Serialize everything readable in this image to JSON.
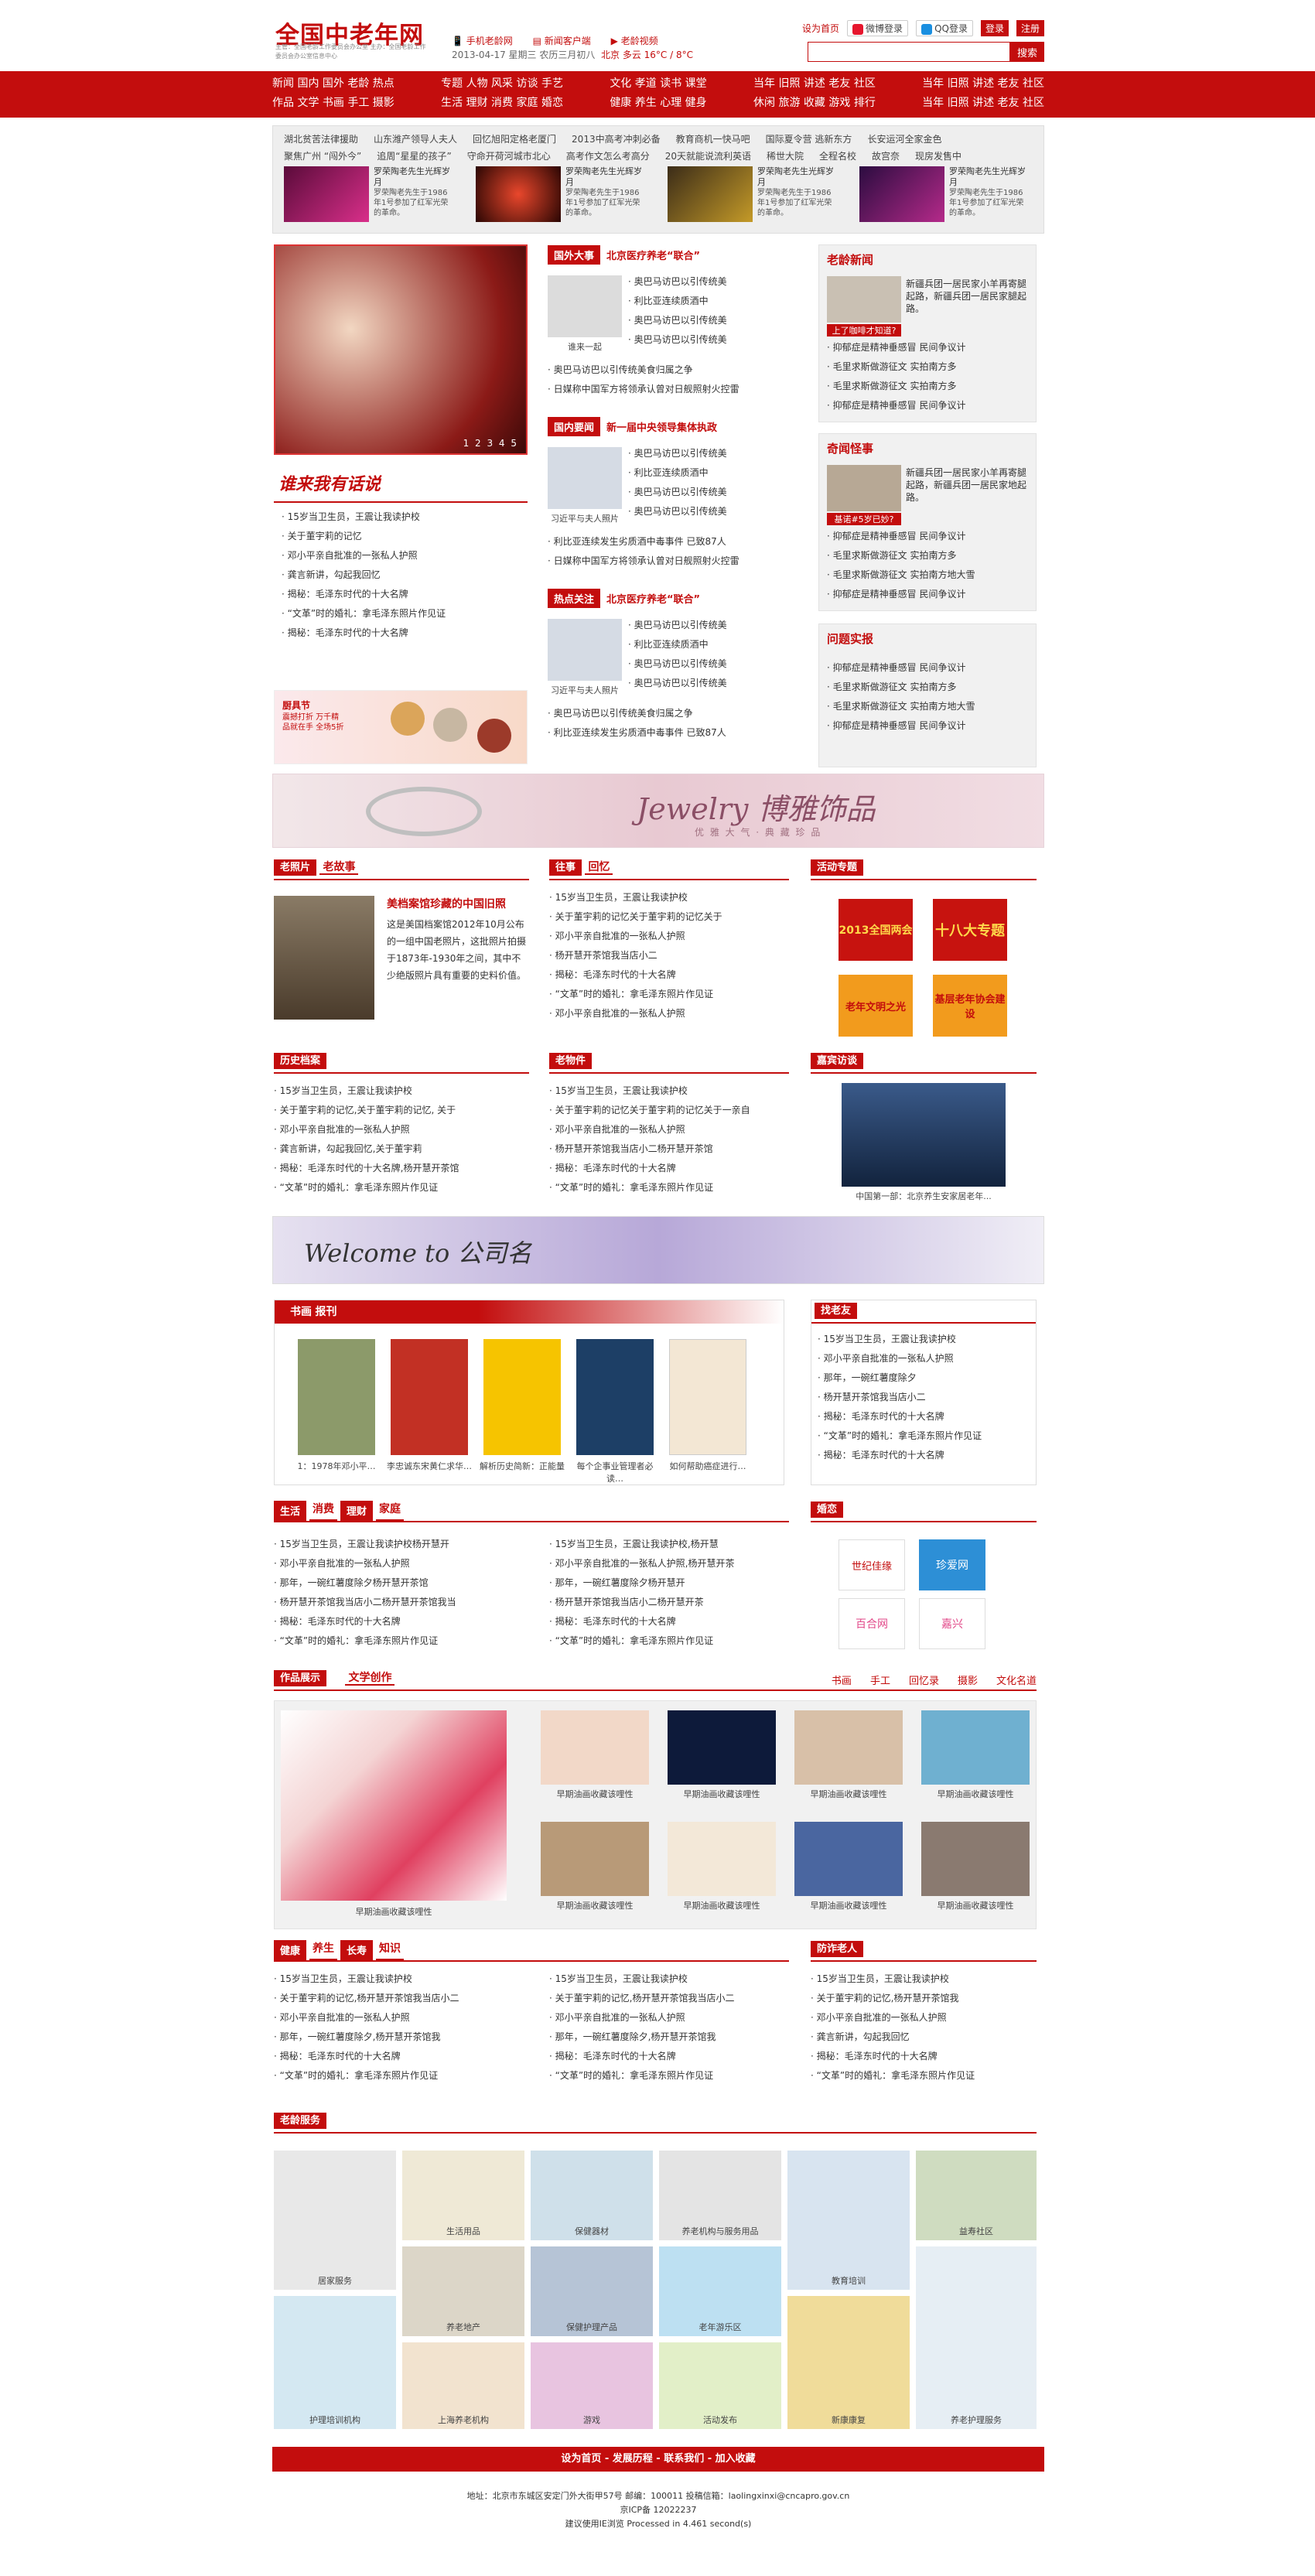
{
  "site": {
    "logo": "全国中老年网",
    "logo_sub": "主管：全国老龄工作委员会办公室 主办：全国老龄工作委员会办公室信息中心",
    "mobile_link": "手机老龄网",
    "client_link": "新闻客户端",
    "subscribe_link": "老龄视频",
    "date": "2013-04-17 星期三 农历三月初八",
    "weather": "北京 多云 16°C / 8°C",
    "set_home": "设为首页",
    "weibo_login": "微博登录",
    "qq_login": "QQ登录",
    "login": "登录",
    "register": "注册",
    "search_button": "搜索"
  },
  "nav": [
    {
      "row1": "新闻 国内 国外 老龄 热点",
      "row2": "作品 文学 书画 手工 摄影"
    },
    {
      "row1": "专题 人物 风采 访谈 手艺",
      "row2": "生活 理财 消费 家庭 婚恋"
    },
    {
      "row1": "文化 孝道 读书 课堂",
      "row2": "健康 养生 心理 健身"
    },
    {
      "row1": "当年 旧照 讲述 老友 社区",
      "row2": "休闲 旅游 收藏 游戏 排行"
    },
    {
      "row1": "当年 旧照 讲述 老友 社区",
      "row2": "当年 旧照 讲述 老友 社区"
    }
  ],
  "ticker": {
    "row1": [
      "湖北贫苦法律援助",
      "山东潍产领导人夫人",
      "回忆旭阳定格老厦门",
      "2013中高考冲刺必备",
      "教育商机一快马吧",
      "国际夏令营 逃新东方",
      "长安运河全家金色"
    ],
    "row2": [
      "聚焦广州 “闯外今”",
      "追周“星星的孩子”",
      "守命开荷河城市北心",
      "高考作文怎么考高分",
      "20天就能说流利英语",
      "稀世大院",
      "全程名校",
      "故宫奈",
      "现房发售中"
    ],
    "promos": [
      {
        "title": "罗荣陶老先生光辉岁月",
        "text": "罗荣陶老先生于1986年1号参加了红军光荣的革命。"
      },
      {
        "title": "罗荣陶老先生光辉岁月",
        "text": "罗荣陶老先生于1986年1号参加了红军光荣的革命。"
      },
      {
        "title": "罗荣陶老先生光辉岁月",
        "text": "罗荣陶老先生于1986年1号参加了红军光荣的革命。"
      },
      {
        "title": "罗荣陶老先生光辉岁月",
        "text": "罗荣陶老先生于1986年1号参加了红军光荣的革命。"
      }
    ]
  },
  "slider_pages": "1 2 3 4 5",
  "talk": {
    "title": "谁来我有话说",
    "items": [
      "15岁当卫生员，王震让我读护校",
      "关于董宇莉的记忆",
      "邓小平亲自批准的一张私人护照",
      "龚言新讲，勾起我回忆",
      "揭秘：毛泽东时代的十大名牌",
      "“文革”时的婚礼：拿毛泽东照片作见证",
      "揭秘：毛泽东时代的十大名牌"
    ]
  },
  "ad_small": {
    "title": "厨具节",
    "text": "震撼打折 万千精品就在手 全场5折"
  },
  "news_sections": [
    {
      "tag": "国外大事",
      "title": "北京医疗养老“联合”",
      "items": [
        "奥巴马访巴以引传统美",
        "利比亚连续质酒中",
        "奥巴马访巴以引传统美",
        "奥巴马访巴以引传统美"
      ],
      "caption": "谁来一起",
      "items2": [
        "奥巴马访巴以引传统美食归属之争",
        "日媒称中国军方将领承认曾对日舰照射火控雷"
      ]
    },
    {
      "tag": "国内要闻",
      "title": "新一届中央领导集体执政",
      "items": [
        "奥巴马访巴以引传统美",
        "利比亚连续质酒中",
        "奥巴马访巴以引传统美",
        "奥巴马访巴以引传统美"
      ],
      "caption": "习近平与夫人照片",
      "items2": [
        "利比亚连续发生劣质酒中毒事件 已致87人",
        "日媒称中国军方将领承认曾对日舰照射火控雷"
      ]
    },
    {
      "tag": "热点关注",
      "title": "北京医疗养老“联合”",
      "items": [
        "奥巴马访巴以引传统美",
        "利比亚连续质酒中",
        "奥巴马访巴以引传统美",
        "奥巴马访巴以引传统美"
      ],
      "caption": "习近平与夫人照片",
      "items2": [
        "奥巴马访巴以引传统美食归属之争",
        "利比亚连续发生劣质酒中毒事件 已致87人"
      ]
    }
  ],
  "right_sections": [
    {
      "title": "老龄新闻",
      "lead": "新疆兵团一居民家小羊再寄腿起路，新疆兵团一居民家腿起路。",
      "caption": "上了咖啡才知道?",
      "items": [
        "抑郁症是精神垂感冒 民间争议计",
        "毛里求斯做游征文 实拍南方多",
        "毛里求斯做游征文 实拍南方多",
        "抑郁症是精神垂感冒 民间争议计"
      ]
    },
    {
      "title": "奇闻怪事",
      "lead": "新疆兵团一居民家小羊再寄腿起路，新疆兵团一居民家地起路。",
      "caption": "基诺#5岁已妙?",
      "items": [
        "抑郁症是精神垂感冒 民间争议计",
        "毛里求斯做游征文 实拍南方多",
        "毛里求斯做游征文 实拍南方地大雪",
        "抑郁症是精神垂感冒 民间争议计"
      ]
    },
    {
      "title": "问题实报",
      "lead": "",
      "caption": "",
      "items": [
        "抑郁症是精神垂感冒 民间争议计",
        "毛里求斯做游征文 实拍南方多",
        "毛里求斯做游征文 实拍南方地大雪",
        "抑郁症是精神垂感冒 民间争议计"
      ]
    }
  ],
  "jewelry_banner": {
    "title": "Jewelry 博雅饰品",
    "sub": "优 雅 大 气 · 典 藏 珍 品"
  },
  "old_photo": {
    "tag": "老照片",
    "tag2": "老故事",
    "headline": "美档案馆珍藏的中国旧照",
    "text": "这是美国档案馆2012年10月公布的一组中国老照片，这批照片拍摄于1873年-1930年之间，其中不少绝版照片具有重要的史料价值。"
  },
  "past": {
    "tag": "往事",
    "tag2": "回忆",
    "items": [
      "15岁当卫生员，王震让我读护校",
      "关于董宇莉的记忆关于董宇莉的记忆关于",
      "邓小平亲自批准的一张私人护照",
      "杨开慧开茶馆我当店小二",
      "揭秘：毛泽东时代的十大名牌",
      "“文革”时的婚礼：拿毛泽东照片作见证",
      "邓小平亲自批准的一张私人护照"
    ]
  },
  "activity": {
    "tag": "活动专题",
    "items": [
      "2013全国两会",
      "十八大专题",
      "老年文明之光",
      "基层老年协会建设"
    ]
  },
  "history": {
    "tag": "历史档案",
    "items": [
      "15岁当卫生员，王震让我读护校",
      "关于董宇莉的记忆,关于董宇莉的记忆, 关于",
      "邓小平亲自批准的一张私人护照",
      "龚言新讲，勾起我回忆,关于董宇莉",
      "揭秘：毛泽东时代的十大名牌,杨开慧开茶馆",
      "“文革”时的婚礼：拿毛泽东照片作见证"
    ]
  },
  "old_stuff": {
    "tag": "老物件",
    "items": [
      "15岁当卫生员，王震让我读护校",
      "关于董宇莉的记忆关于董宇莉的记忆关于一亲自",
      "邓小平亲自批准的一张私人护照",
      "杨开慧开茶馆我当店小二杨开慧开茶馆",
      "揭秘：毛泽东时代的十大名牌",
      "“文革”时的婚礼：拿毛泽东照片作见证"
    ]
  },
  "interview": {
    "tag": "嘉宾访谈",
    "caption": "中国第一部：北京养生安家居老年..."
  },
  "welcome_banner": {
    "text": "Welcome to 公司名"
  },
  "books": {
    "tag": "书画",
    "tag2": "报刊",
    "items": [
      "1：1978年邓小平…",
      "李忠诚东宋黄仁求华…",
      "解析历史简新：正能量",
      "每个企事业管理者必读…",
      "如何帮助癌症进行…"
    ]
  },
  "friends": {
    "tag": "找老友",
    "items": [
      "15岁当卫生员，王震让我读护校",
      "邓小平亲自批准的一张私人护照",
      "那年，一碗红薯度除夕",
      "杨开慧开茶馆我当店小二",
      "揭秘：毛泽东时代的十大名牌",
      "“文革”时的婚礼：拿毛泽东照片作见证",
      "揭秘：毛泽东时代的十大名牌"
    ]
  },
  "life": {
    "tags": [
      "生活",
      "消费",
      "理财",
      "家庭"
    ],
    "col1": [
      "15岁当卫生员，王震让我读护校杨开慧开",
      "邓小平亲自批准的一张私人护照",
      "那年，一碗红薯度除夕杨开慧开茶馆",
      "杨开慧开茶馆我当店小二杨开慧开茶馆我当",
      "揭秘：毛泽东时代的十大名牌",
      "“文革”时的婚礼：拿毛泽东照片作见证"
    ],
    "col2": [
      "15岁当卫生员，王震让我读护校,杨开慧",
      "邓小平亲自批准的一张私人护照,杨开慧开茶",
      "那年，一碗红薯度除夕杨开慧开",
      "杨开慧开茶馆我当店小二杨开慧开茶",
      "揭秘：毛泽东时代的十大名牌",
      "“文革”时的婚礼：拿毛泽东照片作见证"
    ]
  },
  "dating": {
    "tag": "婚恋",
    "logos": [
      "世纪佳缘",
      "珍爱网",
      "百合网",
      "嘉兴"
    ]
  },
  "works": {
    "tag": "作品展示",
    "tag2": "文学创作",
    "links": [
      "书画",
      "手工",
      "回忆录",
      "摄影",
      "文化名道"
    ],
    "main_caption": "早期油画收藏该哩性",
    "captions": [
      "早期油画收藏该哩性",
      "早期油画收藏该哩性",
      "早期油画收藏该哩性",
      "早期油画收藏该哩性",
      "早期油画收藏该哩性",
      "早期油画收藏该哩性",
      "早期油画收藏该哩性",
      "早期油画收藏该哩性"
    ]
  },
  "health": {
    "tags": [
      "健康",
      "养生",
      "长寿",
      "知识"
    ],
    "col1": [
      "15岁当卫生员，王震让我读护校",
      "关于董宇莉的记忆,杨开慧开茶馆我当店小二",
      "邓小平亲自批准的一张私人护照",
      "那年，一碗红薯度除夕,杨开慧开茶馆我",
      "揭秘：毛泽东时代的十大名牌",
      "“文革”时的婚礼：拿毛泽东照片作见证"
    ],
    "col2": [
      "15岁当卫生员，王震让我读护校",
      "关于董宇莉的记忆,杨开慧开茶馆我当店小二",
      "邓小平亲自批准的一张私人护照",
      "那年，一碗红薯度除夕,杨开慧开茶馆我",
      "揭秘：毛泽东时代的十大名牌",
      "“文革”时的婚礼：拿毛泽东照片作见证"
    ]
  },
  "elder_friends": {
    "tag": "防诈老人",
    "items": [
      "15岁当卫生员，王震让我读护校",
      "关于董宇莉的记忆,杨开慧开茶馆我",
      "邓小平亲自批准的一张私人护照",
      "龚言新讲，勾起我回忆",
      "揭秘：毛泽东时代的十大名牌",
      "“文革”时的婚礼：拿毛泽东照片作见证"
    ]
  },
  "services": {
    "tag": "老龄服务",
    "items": [
      "居家服务",
      "生活用品",
      "保健器材",
      "养老机构与服务用品",
      "教育培训",
      "益寿社区",
      "养老地产",
      "保健护理产品",
      "老年游乐区",
      "教育培训",
      "护理培训机构",
      "上海养老机构",
      "游戏",
      "活动发布",
      "新康康复",
      "养老护理服务"
    ]
  },
  "footer": {
    "bar": "设为首页 - 发展历程 - 联系我们 - 加入收藏",
    "address": "地址：北京市东城区安定门外大街甲57号  邮编：100011  投稿信箱：laolingxinxi@cncapro.gov.cn",
    "icp": "京ICP备 12022237",
    "note": "建议使用IE浏览 Processed in 4.461 second(s)"
  }
}
